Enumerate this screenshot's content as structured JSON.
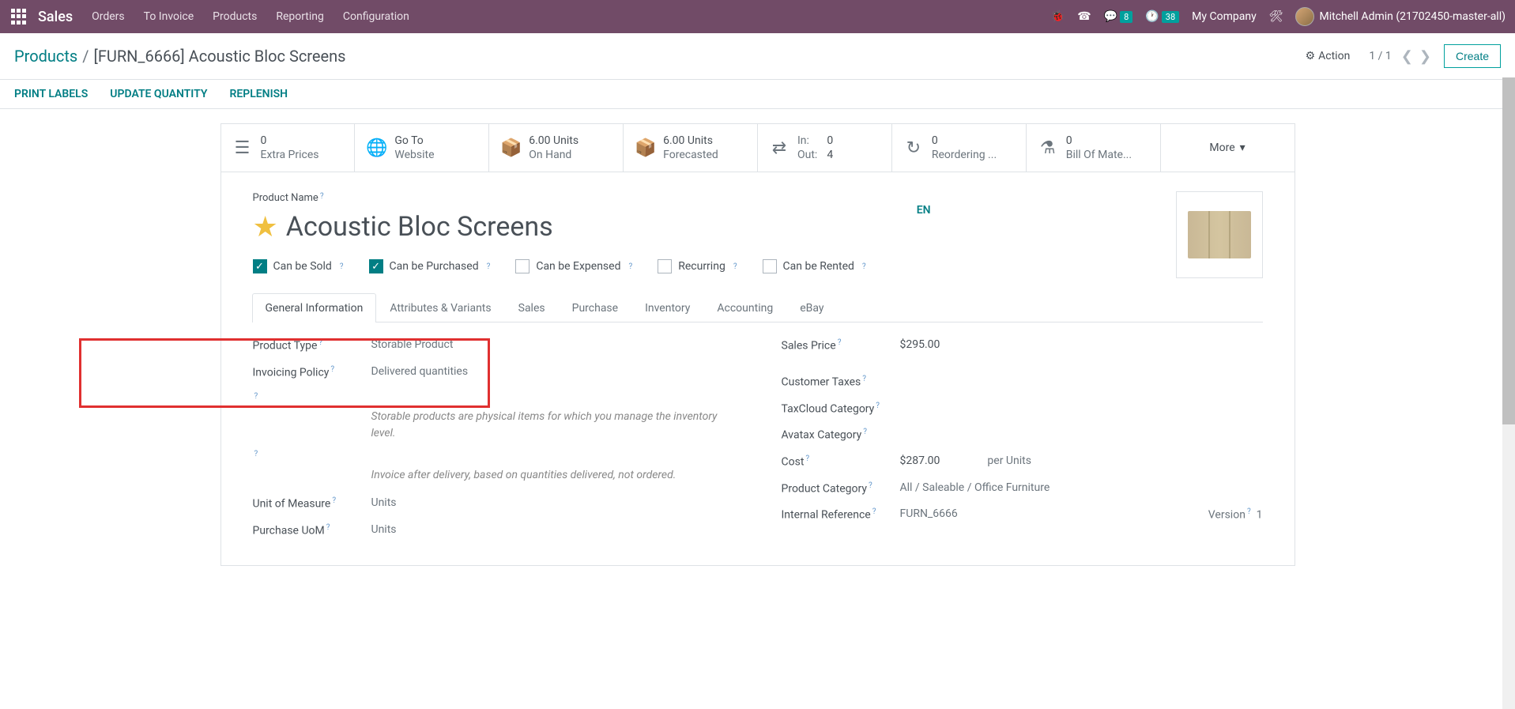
{
  "topbar": {
    "brand": "Sales",
    "nav": [
      "Orders",
      "To Invoice",
      "Products",
      "Reporting",
      "Configuration"
    ],
    "chat_badge": "8",
    "clock_badge": "38",
    "company": "My Company",
    "user": "Mitchell Admin (21702450-master-all)"
  },
  "header": {
    "breadcrumb_root": "Products",
    "breadcrumb_current": "[FURN_6666] Acoustic Bloc Screens",
    "action_label": "Action",
    "pager": "1 / 1",
    "create": "Create"
  },
  "toolbar": [
    "PRINT LABELS",
    "UPDATE QUANTITY",
    "REPLENISH"
  ],
  "stats": [
    {
      "v1": "0",
      "v2": "Extra Prices"
    },
    {
      "v1": "Go To",
      "v2": "Website"
    },
    {
      "v1": "6.00 Units",
      "v2": "On Hand"
    },
    {
      "v1": "6.00 Units",
      "v2": "Forecasted"
    },
    {
      "l1": "In:",
      "l2": "Out:",
      "n1": "0",
      "n2": "4"
    },
    {
      "v1": "0",
      "v2": "Reordering ..."
    },
    {
      "v1": "0",
      "v2": "Bill Of Mate..."
    }
  ],
  "more": "More",
  "product": {
    "name_label": "Product Name",
    "name": "Acoustic Bloc Screens",
    "lang": "EN",
    "checks": [
      {
        "label": "Can be Sold",
        "checked": true
      },
      {
        "label": "Can be Purchased",
        "checked": true
      },
      {
        "label": "Can be Expensed",
        "checked": false
      },
      {
        "label": "Recurring",
        "checked": false
      },
      {
        "label": "Can be Rented",
        "checked": false
      }
    ]
  },
  "tabs": [
    "General Information",
    "Attributes & Variants",
    "Sales",
    "Purchase",
    "Inventory",
    "Accounting",
    "eBay"
  ],
  "form": {
    "left": {
      "product_type_label": "Product Type",
      "product_type": "Storable Product",
      "invoicing_policy_label": "Invoicing Policy",
      "invoicing_policy": "Delivered quantities",
      "hint1": "Storable products are physical items for which you manage the inventory level.",
      "hint2": "Invoice after delivery, based on quantities delivered, not ordered.",
      "uom_label": "Unit of Measure",
      "uom": "Units",
      "puom_label": "Purchase UoM",
      "puom": "Units"
    },
    "right": {
      "sales_price_label": "Sales Price",
      "sales_price": "$295.00",
      "customer_taxes_label": "Customer Taxes",
      "taxcloud_label": "TaxCloud Category",
      "avatax_label": "Avatax Category",
      "cost_label": "Cost",
      "cost": "$287.00",
      "cost_unit": "per Units",
      "category_label": "Product Category",
      "category": "All / Saleable / Office Furniture",
      "ref_label": "Internal Reference",
      "ref": "FURN_6666",
      "version_label": "Version",
      "version": "1"
    }
  }
}
